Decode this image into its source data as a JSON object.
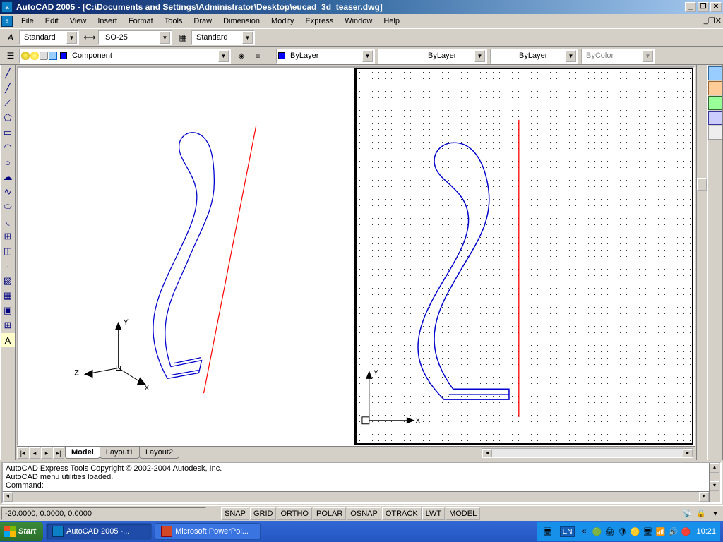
{
  "titlebar": {
    "text": "AutoCAD 2005 - [C:\\Documents and Settings\\Administrator\\Desktop\\eucad_3d_teaser.dwg]"
  },
  "menu": [
    "File",
    "Edit",
    "View",
    "Insert",
    "Format",
    "Tools",
    "Draw",
    "Dimension",
    "Modify",
    "Express",
    "Window",
    "Help"
  ],
  "style_toolbar": {
    "text_style": "Standard",
    "dim_style": "ISO-25",
    "table_style": "Standard"
  },
  "layer_toolbar": {
    "current_layer": "Component",
    "color": "ByLayer",
    "linetype": "ByLayer",
    "lineweight": "ByLayer",
    "plotstyle": "ByColor"
  },
  "tabs": {
    "items": [
      "Model",
      "Layout1",
      "Layout2"
    ],
    "active": 0
  },
  "command": {
    "line1": "AutoCAD Express Tools Copyright © 2002-2004 Autodesk, Inc.",
    "line2": "AutoCAD menu utilities loaded.",
    "prompt": "Command:"
  },
  "statusbar": {
    "coords": "-20.0000, 0.0000, 0.0000",
    "modes": [
      "SNAP",
      "GRID",
      "ORTHO",
      "POLAR",
      "OSNAP",
      "OTRACK",
      "LWT",
      "MODEL"
    ]
  },
  "taskbar": {
    "start": "Start",
    "tasks": [
      {
        "label": "AutoCAD 2005 -...",
        "active": true,
        "color": "#0d7fc4"
      },
      {
        "label": "Microsoft PowerPoi...",
        "active": false,
        "color": "#d24726"
      }
    ],
    "lang": "EN",
    "clock": "10:21"
  },
  "ucs": {
    "x": "X",
    "y": "Y",
    "z": "Z"
  }
}
